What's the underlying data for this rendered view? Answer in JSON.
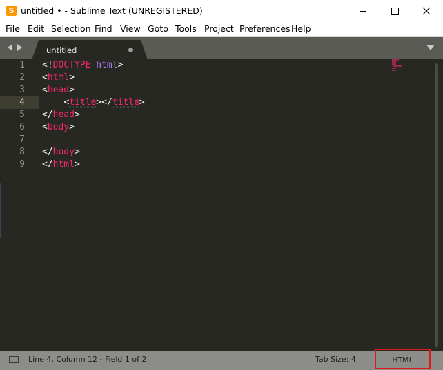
{
  "window": {
    "title": "untitled • - Sublime Text (UNREGISTERED)",
    "app_icon_glyph": "S",
    "controls": [
      "minimize-icon",
      "maximize-icon",
      "close-icon"
    ]
  },
  "menu": {
    "items": [
      "File",
      "Edit",
      "Selection",
      "Find",
      "View",
      "Goto",
      "Tools",
      "Project",
      "Preferences",
      "Help"
    ]
  },
  "tabs": {
    "active": {
      "label": "untitled",
      "dirty": true
    },
    "nav_icons": [
      "chevron-left-icon",
      "chevron-right-icon"
    ],
    "overflow_icon": "chevron-down-icon"
  },
  "editor": {
    "current_line": 4,
    "line_numbers": [
      "1",
      "2",
      "3",
      "4",
      "5",
      "6",
      "7",
      "8",
      "9"
    ],
    "lines": [
      {
        "indent": "",
        "open": "<!",
        "keyword": "DOCTYPE",
        "space": " ",
        "value": "html",
        "close": ">"
      },
      {
        "indent": "",
        "open": "<",
        "name": "html",
        "close": ">"
      },
      {
        "indent": "",
        "open": "<",
        "name": "head",
        "close": ">"
      },
      {
        "indent": "    ",
        "open": "<",
        "name": "title",
        "mid": "></",
        "name2": "title",
        "close": ">"
      },
      {
        "indent": "",
        "open": "</",
        "name": "head",
        "close": ">"
      },
      {
        "indent": "",
        "open": "<",
        "name": "body",
        "close": ">"
      },
      {
        "indent": ""
      },
      {
        "indent": "",
        "open": "</",
        "name": "body",
        "close": ">"
      },
      {
        "indent": "",
        "open": "</",
        "name": "html",
        "close": ">"
      }
    ]
  },
  "status": {
    "position": "Line 4, Column 12 - Field 1 of 2",
    "tab_size": "Tab Size: 4",
    "syntax": "HTML",
    "highlight_color": "#e01818"
  },
  "colors": {
    "editor_bg": "#272822",
    "tag": "#f92672",
    "keyword_value": "#ae81ff",
    "text": "#f8f8f2",
    "gutter_text": "#8f908a"
  }
}
